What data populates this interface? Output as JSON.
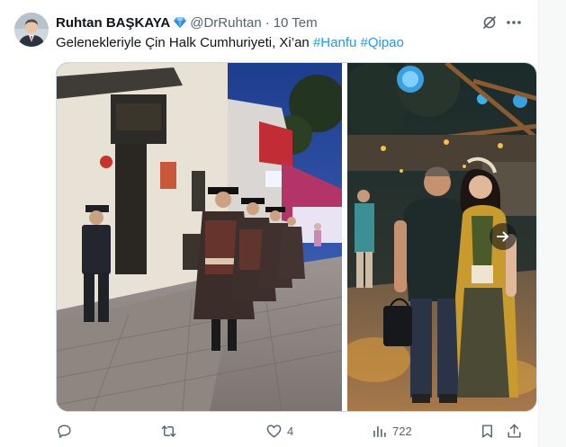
{
  "tweet": {
    "author_name": "Ruhtan BAŞKAYA",
    "handle": "@DrRuhtan",
    "separator": "·",
    "time": "10 Tem",
    "text_plain": "Gelenekleriyle Çin Halk Cumhuriyeti, Xi’an ",
    "hashtags": [
      "#Hanfu",
      "#Qipao"
    ],
    "icons": {
      "verified": "verified-gem-icon",
      "grok": "grok-icon",
      "more": "more-dots-icon",
      "next": "arrow-right-icon",
      "reply": "reply-icon",
      "retweet": "retweet-icon",
      "like": "heart-icon",
      "views": "views-icon",
      "bookmark": "bookmark-icon",
      "share": "share-icon"
    }
  },
  "stats": {
    "replies": "",
    "retweets": "",
    "likes": "4",
    "views": "722"
  },
  "colors": {
    "text": "#0f1419",
    "secondary": "#536471",
    "accent": "#1d9bf0",
    "verified": "#3a9dd7",
    "border": "#cfd9de"
  }
}
